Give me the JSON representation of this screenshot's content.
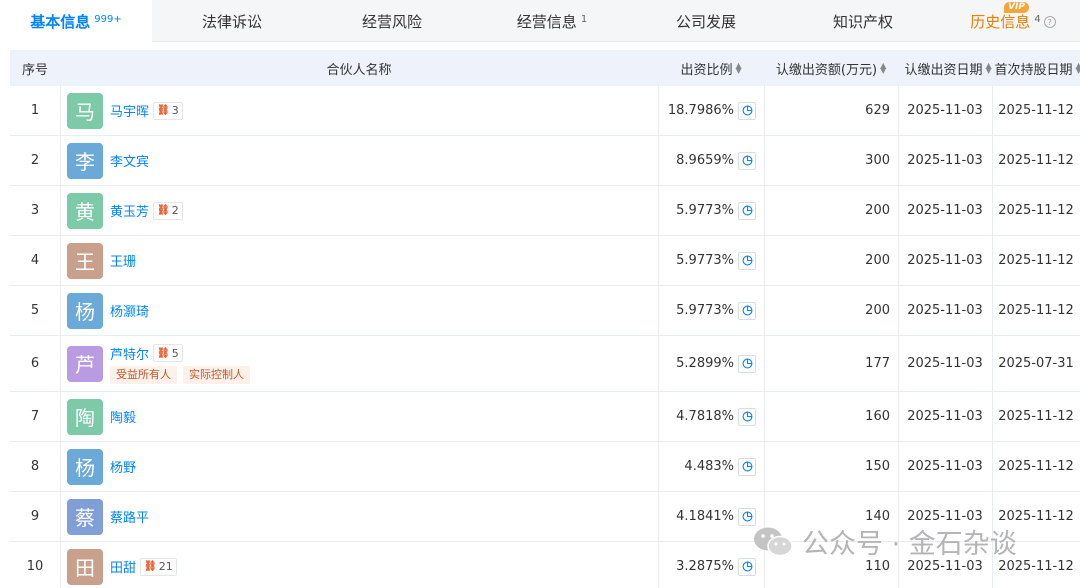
{
  "tabs": [
    {
      "label": "基本信息",
      "count": "999+",
      "active": true
    },
    {
      "label": "法律诉讼",
      "count": ""
    },
    {
      "label": "经营风险",
      "count": ""
    },
    {
      "label": "经营信息",
      "count": "1"
    },
    {
      "label": "公司发展",
      "count": ""
    },
    {
      "label": "知识产权",
      "count": ""
    },
    {
      "label": "历史信息",
      "count": "4",
      "badge": "VIP"
    }
  ],
  "table": {
    "headers": {
      "index": "序号",
      "name": "合伙人名称",
      "ratio": "出资比例",
      "amount": "认缴出资额(万元)",
      "date1": "认缴出资日期",
      "date2": "首次持股日期"
    },
    "rows": [
      {
        "index": "1",
        "avatar": "马",
        "color": "#7ccaa8",
        "name": "马宇晖",
        "rel": "3",
        "tags": [],
        "ratio": "18.7986%",
        "amount": "629",
        "date1": "2025-11-03",
        "date2": "2025-11-12"
      },
      {
        "index": "2",
        "avatar": "李",
        "color": "#6aa9d8",
        "name": "李文宾",
        "rel": "",
        "tags": [],
        "ratio": "8.9659%",
        "amount": "300",
        "date1": "2025-11-03",
        "date2": "2025-11-12"
      },
      {
        "index": "3",
        "avatar": "黄",
        "color": "#7ccaa8",
        "name": "黄玉芳",
        "rel": "2",
        "tags": [],
        "ratio": "5.9773%",
        "amount": "200",
        "date1": "2025-11-03",
        "date2": "2025-11-12"
      },
      {
        "index": "4",
        "avatar": "王",
        "color": "#c9a08b",
        "name": "王珊",
        "rel": "",
        "tags": [],
        "ratio": "5.9773%",
        "amount": "200",
        "date1": "2025-11-03",
        "date2": "2025-11-12"
      },
      {
        "index": "5",
        "avatar": "杨",
        "color": "#6aa9d8",
        "name": "杨灏琦",
        "rel": "",
        "tags": [],
        "ratio": "5.9773%",
        "amount": "200",
        "date1": "2025-11-03",
        "date2": "2025-11-12"
      },
      {
        "index": "6",
        "avatar": "芦",
        "color": "#b89be0",
        "name": "芦特尔",
        "rel": "5",
        "tags": [
          "受益所有人",
          "实际控制人"
        ],
        "ratio": "5.2899%",
        "amount": "177",
        "date1": "2025-11-03",
        "date2": "2025-07-31"
      },
      {
        "index": "7",
        "avatar": "陶",
        "color": "#7ccaa8",
        "name": "陶毅",
        "rel": "",
        "tags": [],
        "ratio": "4.7818%",
        "amount": "160",
        "date1": "2025-11-03",
        "date2": "2025-11-12"
      },
      {
        "index": "8",
        "avatar": "杨",
        "color": "#6aa9d8",
        "name": "杨野",
        "rel": "",
        "tags": [],
        "ratio": "4.483%",
        "amount": "150",
        "date1": "2025-11-03",
        "date2": "2025-11-12"
      },
      {
        "index": "9",
        "avatar": "蔡",
        "color": "#7f9fd6",
        "name": "蔡路平",
        "rel": "",
        "tags": [],
        "ratio": "4.1841%",
        "amount": "140",
        "date1": "2025-11-03",
        "date2": "2025-11-12"
      },
      {
        "index": "10",
        "avatar": "田",
        "color": "#c9a08b",
        "name": "田甜",
        "rel": "21",
        "tags": [],
        "ratio": "3.2875%",
        "amount": "110",
        "date1": "2025-11-03",
        "date2": "2025-11-12"
      }
    ]
  },
  "watermark": {
    "text": "公众号 · 金石杂谈"
  },
  "icons": {
    "relation": "relation-icon",
    "pie": "pie-chart-icon",
    "sort": "sort-icon",
    "help": "help-icon",
    "wechat": "wechat-icon"
  }
}
